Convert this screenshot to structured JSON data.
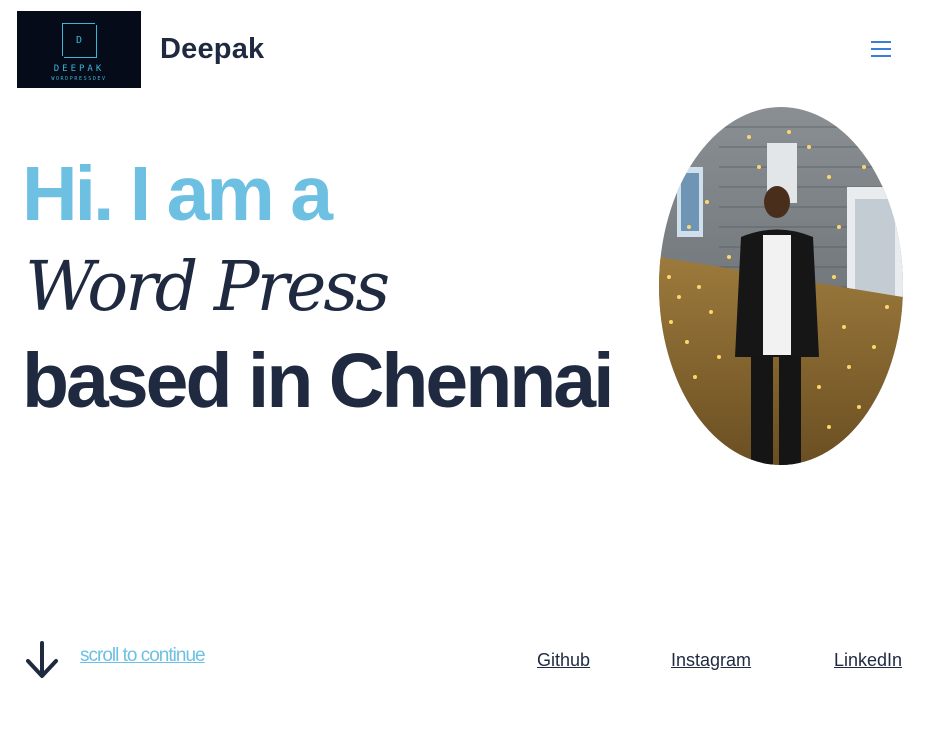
{
  "header": {
    "logo": {
      "letter": "D",
      "name": "DEEPAK",
      "tagline": "WORDPRESSDEV"
    },
    "site_title": "Deepak",
    "menu_icon": "hamburger-menu-icon"
  },
  "hero": {
    "line1": "Hi. I am a",
    "line2": "Word Press",
    "line3": "based in Chennai",
    "photo": "profile-photo"
  },
  "footer": {
    "scroll_icon": "arrow-down-icon",
    "scroll_text": "scroll to continue",
    "links": [
      "Github",
      "Instagram",
      "LinkedIn"
    ]
  },
  "colors": {
    "accent": "#6ec0e2",
    "text": "#1f2a40",
    "menu": "#3a7fd5",
    "logo_bg": "#050b18",
    "logo_fg": "#3ab7d8"
  }
}
